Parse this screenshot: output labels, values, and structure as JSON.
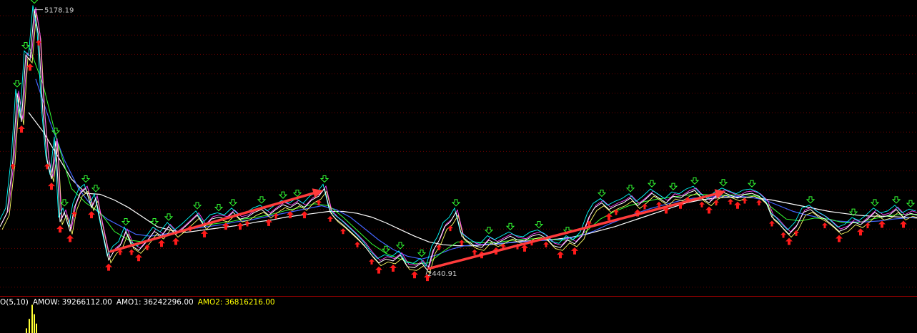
{
  "chart_data": {
    "type": "line",
    "annotations": {
      "high_label": "5178.19",
      "low_label": "2440.91"
    },
    "y_range": [
      2300,
      5250
    ],
    "grid": true,
    "series_colors": {
      "price": "#ffffff",
      "ma_white": "#ffffff",
      "ma_yellow": "#ffff66",
      "ma_green": "#33ff33",
      "ma_blue": "#4466ff",
      "ma_magenta": "#ff44ff",
      "ma_cyan": "#00ffff"
    },
    "price": [
      [
        0,
        2900
      ],
      [
        10,
        3050
      ],
      [
        18,
        3600
      ],
      [
        24,
        4300
      ],
      [
        30,
        4000
      ],
      [
        36,
        4700
      ],
      [
        42,
        4650
      ],
      [
        48,
        5178.19
      ],
      [
        54,
        4900
      ],
      [
        60,
        4100
      ],
      [
        66,
        3600
      ],
      [
        72,
        3400
      ],
      [
        78,
        3800
      ],
      [
        84,
        2950
      ],
      [
        90,
        3050
      ],
      [
        98,
        2850
      ],
      [
        104,
        3100
      ],
      [
        112,
        3250
      ],
      [
        120,
        3300
      ],
      [
        128,
        3100
      ],
      [
        134,
        3200
      ],
      [
        142,
        2900
      ],
      [
        152,
        2550
      ],
      [
        160,
        2650
      ],
      [
        168,
        2700
      ],
      [
        176,
        2850
      ],
      [
        184,
        2700
      ],
      [
        194,
        2650
      ],
      [
        206,
        2750
      ],
      [
        216,
        2850
      ],
      [
        226,
        2800
      ],
      [
        236,
        2900
      ],
      [
        246,
        2820
      ],
      [
        256,
        2880
      ],
      [
        266,
        2950
      ],
      [
        276,
        3020
      ],
      [
        286,
        2900
      ],
      [
        296,
        2980
      ],
      [
        306,
        3000
      ],
      [
        316,
        2980
      ],
      [
        326,
        3050
      ],
      [
        336,
        2980
      ],
      [
        346,
        3000
      ],
      [
        356,
        3050
      ],
      [
        366,
        3080
      ],
      [
        376,
        3020
      ],
      [
        386,
        3080
      ],
      [
        396,
        3130
      ],
      [
        406,
        3100
      ],
      [
        416,
        3150
      ],
      [
        426,
        3100
      ],
      [
        436,
        3180
      ],
      [
        446,
        3220
      ],
      [
        454,
        3300
      ],
      [
        462,
        3050
      ],
      [
        470,
        2980
      ],
      [
        480,
        2920
      ],
      [
        490,
        2850
      ],
      [
        500,
        2780
      ],
      [
        510,
        2700
      ],
      [
        520,
        2600
      ],
      [
        530,
        2520
      ],
      [
        540,
        2560
      ],
      [
        550,
        2540
      ],
      [
        560,
        2600
      ],
      [
        570,
        2480
      ],
      [
        580,
        2470
      ],
      [
        590,
        2520
      ],
      [
        598,
        2440.91
      ],
      [
        606,
        2650
      ],
      [
        614,
        2750
      ],
      [
        622,
        2900
      ],
      [
        630,
        2950
      ],
      [
        638,
        3050
      ],
      [
        646,
        2800
      ],
      [
        654,
        2750
      ],
      [
        664,
        2700
      ],
      [
        674,
        2680
      ],
      [
        684,
        2760
      ],
      [
        694,
        2720
      ],
      [
        704,
        2760
      ],
      [
        714,
        2800
      ],
      [
        724,
        2760
      ],
      [
        734,
        2750
      ],
      [
        744,
        2800
      ],
      [
        754,
        2820
      ],
      [
        764,
        2780
      ],
      [
        774,
        2700
      ],
      [
        784,
        2680
      ],
      [
        794,
        2760
      ],
      [
        804,
        2720
      ],
      [
        814,
        2800
      ],
      [
        824,
        3000
      ],
      [
        832,
        3100
      ],
      [
        842,
        3150
      ],
      [
        852,
        3080
      ],
      [
        862,
        3120
      ],
      [
        872,
        3150
      ],
      [
        882,
        3200
      ],
      [
        892,
        3120
      ],
      [
        902,
        3180
      ],
      [
        912,
        3250
      ],
      [
        922,
        3200
      ],
      [
        932,
        3150
      ],
      [
        942,
        3220
      ],
      [
        952,
        3200
      ],
      [
        962,
        3250
      ],
      [
        972,
        3280
      ],
      [
        982,
        3200
      ],
      [
        992,
        3150
      ],
      [
        1002,
        3220
      ],
      [
        1012,
        3260
      ],
      [
        1022,
        3230
      ],
      [
        1032,
        3200
      ],
      [
        1042,
        3240
      ],
      [
        1052,
        3250
      ],
      [
        1062,
        3220
      ],
      [
        1072,
        3150
      ],
      [
        1080,
        3000
      ],
      [
        1088,
        2950
      ],
      [
        1096,
        2880
      ],
      [
        1104,
        2820
      ],
      [
        1114,
        2900
      ],
      [
        1124,
        3050
      ],
      [
        1134,
        3080
      ],
      [
        1144,
        3020
      ],
      [
        1154,
        2980
      ],
      [
        1164,
        2920
      ],
      [
        1174,
        2850
      ],
      [
        1184,
        2880
      ],
      [
        1194,
        2950
      ],
      [
        1204,
        2920
      ],
      [
        1214,
        2980
      ],
      [
        1224,
        3050
      ],
      [
        1234,
        3000
      ],
      [
        1244,
        3020
      ],
      [
        1254,
        3080
      ],
      [
        1264,
        3000
      ],
      [
        1274,
        3040
      ],
      [
        1283,
        3020
      ]
    ],
    "ma_white": [
      [
        40,
        4100
      ],
      [
        60,
        3900
      ],
      [
        80,
        3650
      ],
      [
        100,
        3400
      ],
      [
        120,
        3250
      ],
      [
        140,
        3240
      ],
      [
        160,
        3180
      ],
      [
        180,
        3100
      ],
      [
        200,
        3000
      ],
      [
        220,
        2900
      ],
      [
        240,
        2860
      ],
      [
        260,
        2840
      ],
      [
        280,
        2860
      ],
      [
        300,
        2880
      ],
      [
        320,
        2900
      ],
      [
        340,
        2920
      ],
      [
        360,
        2950
      ],
      [
        380,
        2970
      ],
      [
        400,
        3000
      ],
      [
        420,
        3020
      ],
      [
        440,
        3040
      ],
      [
        460,
        3060
      ],
      [
        480,
        3060
      ],
      [
        500,
        3040
      ],
      [
        520,
        3000
      ],
      [
        540,
        2940
      ],
      [
        560,
        2870
      ],
      [
        580,
        2800
      ],
      [
        600,
        2740
      ],
      [
        620,
        2710
      ],
      [
        640,
        2700
      ],
      [
        660,
        2700
      ],
      [
        680,
        2710
      ],
      [
        700,
        2720
      ],
      [
        720,
        2740
      ],
      [
        740,
        2750
      ],
      [
        760,
        2760
      ],
      [
        780,
        2770
      ],
      [
        800,
        2790
      ],
      [
        820,
        2820
      ],
      [
        840,
        2860
      ],
      [
        860,
        2900
      ],
      [
        880,
        2950
      ],
      [
        900,
        3000
      ],
      [
        920,
        3050
      ],
      [
        940,
        3100
      ],
      [
        960,
        3150
      ],
      [
        980,
        3180
      ],
      [
        1000,
        3200
      ],
      [
        1020,
        3210
      ],
      [
        1040,
        3210
      ],
      [
        1060,
        3200
      ],
      [
        1080,
        3180
      ],
      [
        1100,
        3150
      ],
      [
        1120,
        3120
      ],
      [
        1140,
        3090
      ],
      [
        1160,
        3060
      ],
      [
        1180,
        3040
      ],
      [
        1200,
        3020
      ],
      [
        1220,
        3010
      ],
      [
        1240,
        3010
      ],
      [
        1260,
        3000
      ],
      [
        1283,
        2990
      ]
    ],
    "ma_blue": [
      [
        50,
        4450
      ],
      [
        70,
        4000
      ],
      [
        90,
        3600
      ],
      [
        110,
        3300
      ],
      [
        130,
        3100
      ],
      [
        150,
        2980
      ],
      [
        170,
        2900
      ],
      [
        190,
        2820
      ],
      [
        210,
        2800
      ],
      [
        230,
        2820
      ],
      [
        250,
        2850
      ],
      [
        270,
        2880
      ],
      [
        290,
        2900
      ],
      [
        310,
        2920
      ],
      [
        330,
        2950
      ],
      [
        350,
        2970
      ],
      [
        370,
        3000
      ],
      [
        390,
        3030
      ],
      [
        410,
        3060
      ],
      [
        430,
        3090
      ],
      [
        450,
        3120
      ],
      [
        470,
        3080
      ],
      [
        490,
        3000
      ],
      [
        510,
        2880
      ],
      [
        530,
        2760
      ],
      [
        550,
        2660
      ],
      [
        570,
        2590
      ],
      [
        590,
        2560
      ],
      [
        610,
        2600
      ],
      [
        630,
        2660
      ],
      [
        650,
        2700
      ],
      [
        670,
        2710
      ],
      [
        690,
        2720
      ],
      [
        710,
        2730
      ],
      [
        730,
        2740
      ],
      [
        750,
        2750
      ],
      [
        770,
        2760
      ],
      [
        790,
        2770
      ],
      [
        810,
        2800
      ],
      [
        830,
        2850
      ],
      [
        850,
        2920
      ],
      [
        870,
        2980
      ],
      [
        890,
        3040
      ],
      [
        910,
        3090
      ],
      [
        930,
        3130
      ],
      [
        950,
        3170
      ],
      [
        970,
        3200
      ],
      [
        990,
        3210
      ],
      [
        1010,
        3220
      ],
      [
        1030,
        3220
      ],
      [
        1050,
        3210
      ],
      [
        1070,
        3180
      ],
      [
        1090,
        3120
      ],
      [
        1110,
        3060
      ],
      [
        1130,
        3020
      ],
      [
        1150,
        2990
      ],
      [
        1170,
        2960
      ],
      [
        1190,
        2950
      ],
      [
        1210,
        2950
      ],
      [
        1230,
        2960
      ],
      [
        1250,
        2980
      ],
      [
        1283,
        3000
      ]
    ],
    "ma_green": [
      [
        40,
        4800
      ],
      [
        60,
        4400
      ],
      [
        80,
        3800
      ],
      [
        100,
        3300
      ],
      [
        120,
        3150
      ],
      [
        140,
        3050
      ],
      [
        160,
        2850
      ],
      [
        180,
        2760
      ],
      [
        200,
        2740
      ],
      [
        220,
        2780
      ],
      [
        240,
        2830
      ],
      [
        260,
        2870
      ],
      [
        280,
        2900
      ],
      [
        300,
        2930
      ],
      [
        320,
        2950
      ],
      [
        340,
        2980
      ],
      [
        360,
        3000
      ],
      [
        380,
        3030
      ],
      [
        400,
        3070
      ],
      [
        420,
        3100
      ],
      [
        440,
        3140
      ],
      [
        460,
        3120
      ],
      [
        480,
        3000
      ],
      [
        500,
        2860
      ],
      [
        520,
        2720
      ],
      [
        540,
        2620
      ],
      [
        560,
        2560
      ],
      [
        580,
        2510
      ],
      [
        600,
        2520
      ],
      [
        620,
        2640
      ],
      [
        640,
        2740
      ],
      [
        660,
        2740
      ],
      [
        680,
        2730
      ],
      [
        700,
        2740
      ],
      [
        720,
        2760
      ],
      [
        740,
        2770
      ],
      [
        760,
        2780
      ],
      [
        780,
        2760
      ],
      [
        800,
        2760
      ],
      [
        820,
        2850
      ],
      [
        840,
        2980
      ],
      [
        860,
        3060
      ],
      [
        880,
        3120
      ],
      [
        900,
        3160
      ],
      [
        920,
        3190
      ],
      [
        940,
        3210
      ],
      [
        960,
        3230
      ],
      [
        980,
        3240
      ],
      [
        1000,
        3230
      ],
      [
        1020,
        3230
      ],
      [
        1040,
        3240
      ],
      [
        1060,
        3220
      ],
      [
        1080,
        3100
      ],
      [
        1100,
        2980
      ],
      [
        1120,
        2960
      ],
      [
        1140,
        2990
      ],
      [
        1160,
        2980
      ],
      [
        1180,
        2940
      ],
      [
        1200,
        2940
      ],
      [
        1220,
        2980
      ],
      [
        1240,
        3010
      ],
      [
        1260,
        3030
      ],
      [
        1283,
        3030
      ]
    ],
    "arrows": [
      {
        "from": [
          155,
          2640
        ],
        "to": [
          452,
          3280
        ]
      },
      {
        "from": [
          600,
          2460
        ],
        "to": [
          1015,
          3270
        ]
      }
    ]
  },
  "indicator_bar": {
    "prefix": "O(5,10)",
    "amow_label": "AMOW:",
    "amow_value": "39266112.00",
    "amo1_label": "AMO1:",
    "amo1_value": "36242296.00",
    "amo2_label": "AMO2:",
    "amo2_value": "36816216.00",
    "colors": {
      "amow": "#ffffff",
      "amo1": "#ffffff",
      "amo2": "#ffff00",
      "prefix": "#ffffff"
    }
  },
  "volume_preview": [
    [
      36,
      3
    ],
    [
      40,
      9
    ],
    [
      44,
      18
    ],
    [
      47,
      12
    ],
    [
      50,
      6
    ]
  ]
}
